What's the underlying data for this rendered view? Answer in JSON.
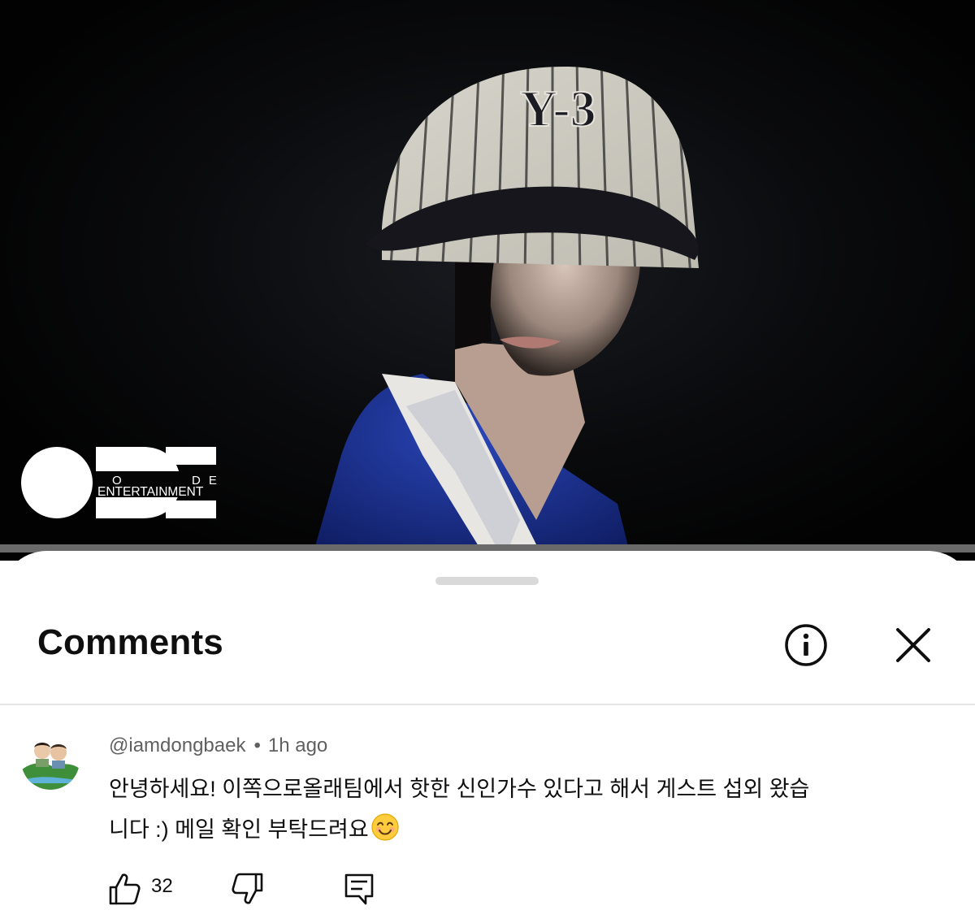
{
  "video": {
    "logo": {
      "letter_o": "O",
      "letters_de": "DE",
      "company": "ENTERTAINMENT"
    },
    "cap_text": "Y-3"
  },
  "comments_panel": {
    "title": "Comments",
    "info_icon": "info-circle-icon",
    "close_icon": "close-x-icon"
  },
  "comment": {
    "handle": "@iamdongbaek",
    "separator": "•",
    "time": "1h ago",
    "text_line1": "안녕하세요! 이쪽으로올래팀에서 핫한 신인가수 있다고 해서 게스트 섭외 왔습",
    "text_line2": "니다 :) 메일 확인 부탁드려요",
    "emoji": "smiling-face-emoji",
    "like_count": "32",
    "like_icon": "thumbs-up-icon",
    "dislike_icon": "thumbs-down-icon",
    "reply_icon": "reply-comment-icon"
  },
  "colors": {
    "video_bg": "#050505",
    "sheet_bg": "#ffffff",
    "text_primary": "#0f0f0f",
    "text_secondary": "#606060",
    "divider": "#e5e5e5",
    "handle": "#d9d9d9"
  }
}
